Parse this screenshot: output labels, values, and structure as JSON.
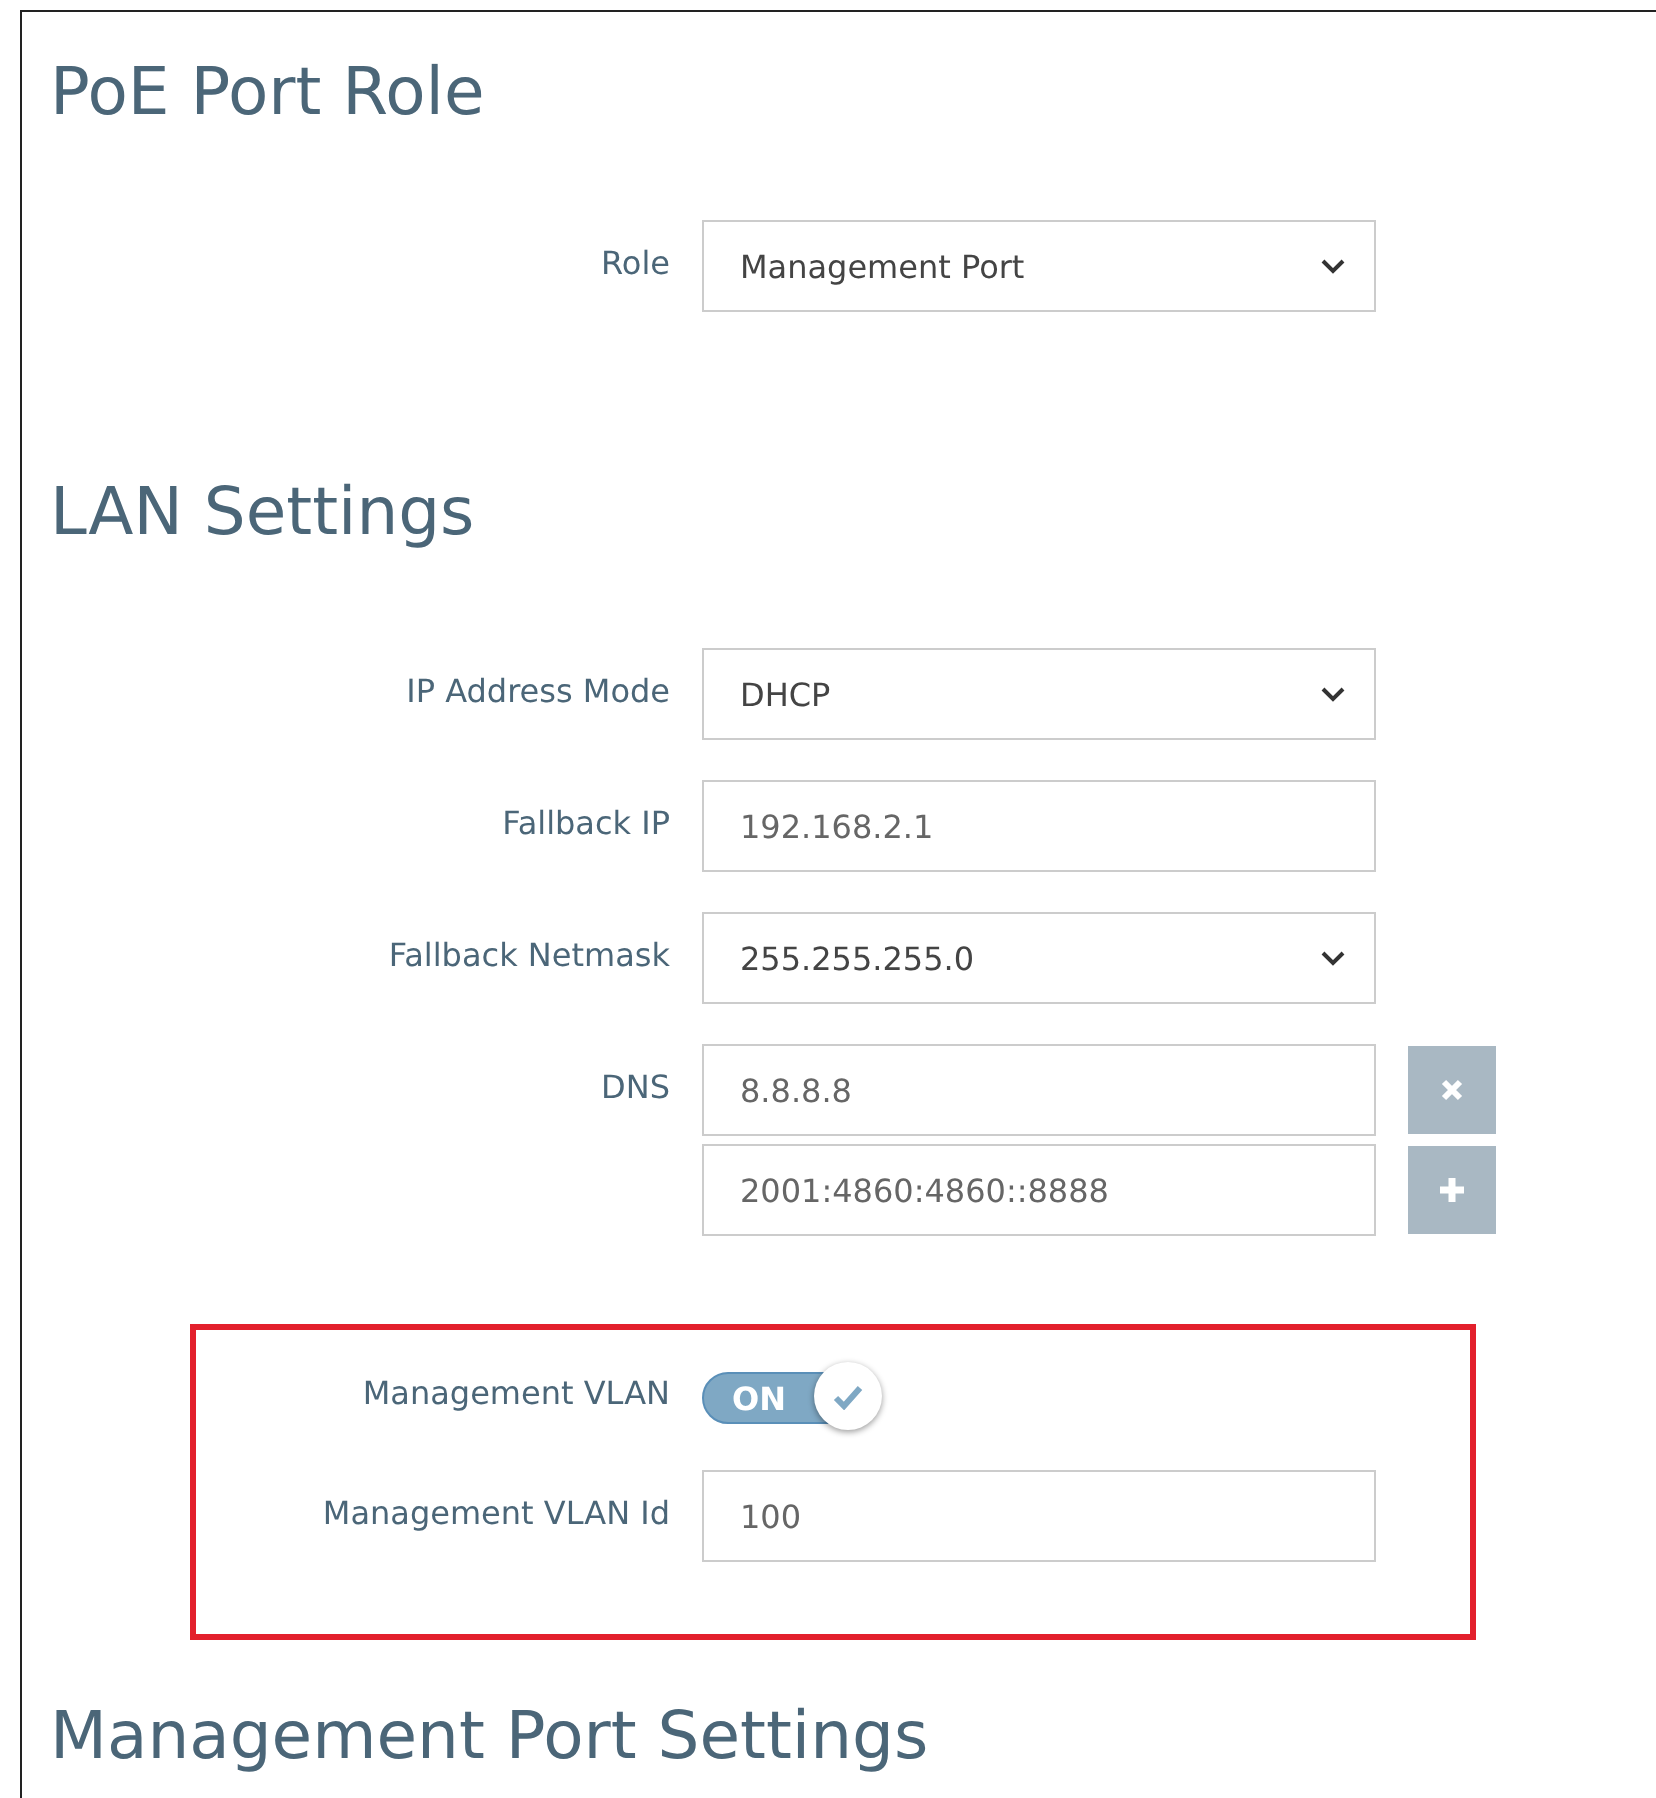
{
  "sections": [
    {
      "title": "PoE Port Role",
      "fields": [
        {
          "kind": "select",
          "label": "Role",
          "value": "Management Port"
        }
      ]
    },
    {
      "title": "LAN Settings",
      "fields": [
        {
          "kind": "select",
          "label": "IP Address Mode",
          "value": "DHCP"
        },
        {
          "kind": "input",
          "label": "Fallback IP",
          "value": "192.168.2.1"
        },
        {
          "kind": "select",
          "label": "Fallback Netmask",
          "value": "255.255.255.0"
        },
        {
          "kind": "list",
          "label": "DNS",
          "values": [
            "8.8.8.8",
            "2001:4860:4860::8888"
          ]
        }
      ],
      "highlighted_fields": [
        {
          "kind": "toggle",
          "label": "Management VLAN",
          "on": true,
          "text": "ON"
        },
        {
          "kind": "input",
          "label": "Management VLAN Id",
          "value": "100"
        }
      ]
    },
    {
      "title": "Management Port Settings"
    }
  ]
}
